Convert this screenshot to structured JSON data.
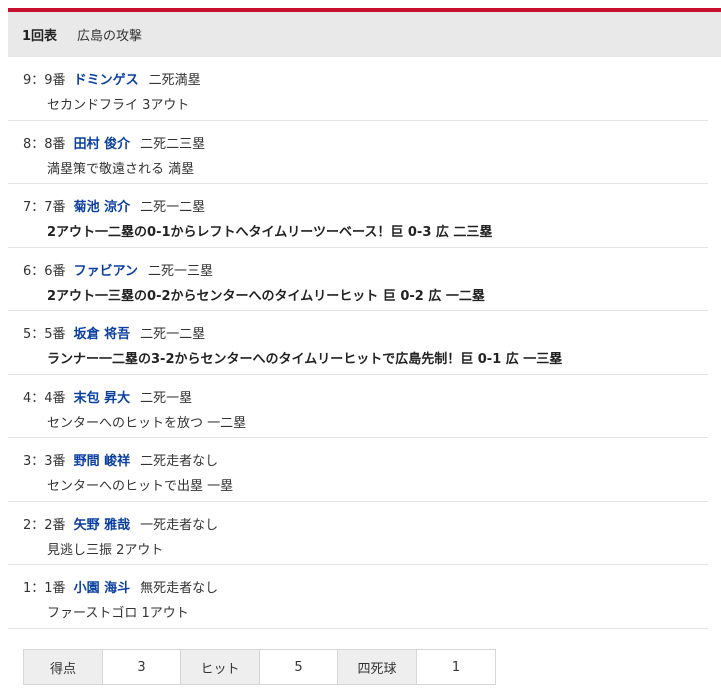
{
  "header": {
    "inning": "1回表",
    "team_attack": "広島の攻撃"
  },
  "plays": [
    {
      "num": "9：",
      "order": "9番",
      "player": "ドミンゲス",
      "situation": "二死満塁",
      "result": "セカンドフライ 3アウト",
      "bold": false
    },
    {
      "num": "8：",
      "order": "8番",
      "player": "田村 俊介",
      "situation": "二死二三塁",
      "result": "満塁策で敬遠される 満塁",
      "bold": false
    },
    {
      "num": "7：",
      "order": "7番",
      "player": "菊池 涼介",
      "situation": "二死一二塁",
      "result": "2アウト一二塁の0-1からレフトへタイムリーツーベース！巨 0-3 広 二三塁",
      "bold": true
    },
    {
      "num": "6：",
      "order": "6番",
      "player": "ファビアン",
      "situation": "二死一三塁",
      "result": "2アウト一三塁の0-2からセンターへのタイムリーヒット 巨 0-2 広 一二塁",
      "bold": true
    },
    {
      "num": "5：",
      "order": "5番",
      "player": "坂倉 将吾",
      "situation": "二死一二塁",
      "result": "ランナー一二塁の3-2からセンターへのタイムリーヒットで広島先制！巨 0-1 広 一三塁",
      "bold": true
    },
    {
      "num": "4：",
      "order": "4番",
      "player": "末包 昇大",
      "situation": "二死一塁",
      "result": "センターへのヒットを放つ 一二塁",
      "bold": false
    },
    {
      "num": "3：",
      "order": "3番",
      "player": "野間 峻祥",
      "situation": "二死走者なし",
      "result": "センターへのヒットで出塁 一塁",
      "bold": false
    },
    {
      "num": "2：",
      "order": "2番",
      "player": "矢野 雅哉",
      "situation": "一死走者なし",
      "result": "見逃し三振 2アウト",
      "bold": false
    },
    {
      "num": "1：",
      "order": "1番",
      "player": "小園 海斗",
      "situation": "無死走者なし",
      "result": "ファーストゴロ 1アウト",
      "bold": false
    }
  ],
  "totals": {
    "runs_label": "得点",
    "runs": "3",
    "hits_label": "ヒット",
    "hits": "5",
    "walks_label": "四死球",
    "walks": "1"
  },
  "colors": {
    "accent": "#c8102e",
    "player_link": "#0b3fa0"
  }
}
